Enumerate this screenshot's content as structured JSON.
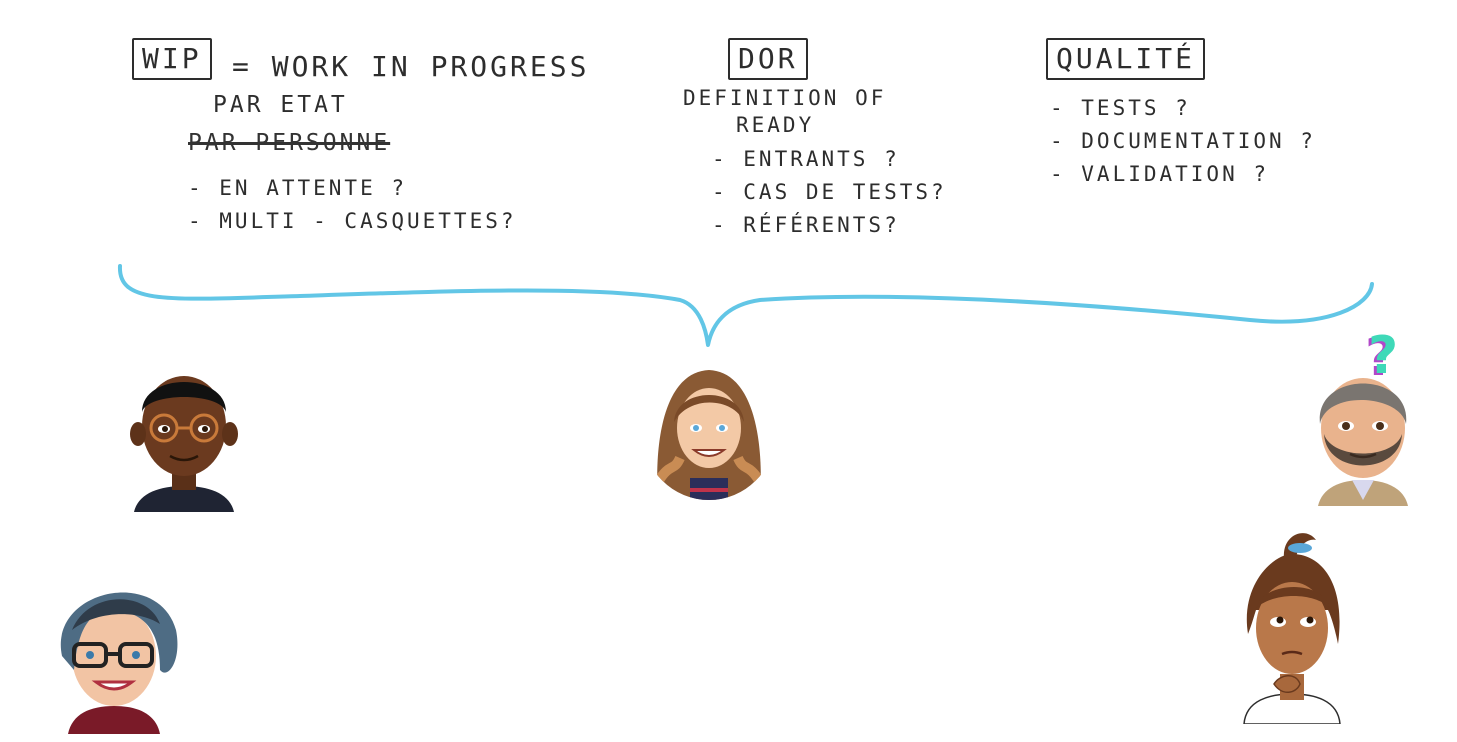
{
  "wip": {
    "box_label": "WIP",
    "equals": "= WORK IN PROGRESS",
    "line1": "PAR ETAT",
    "line2_struck": "PAR PERSONNE",
    "items": [
      "- EN ATTENTE ?",
      "- MULTI - CASQUETTES?"
    ]
  },
  "dor": {
    "box_label": "DOR",
    "line1": "DEFINITION OF",
    "line2": "READY",
    "items": [
      "- ENTRANTS ?",
      "- CAS DE TESTS?",
      "- RÉFÉRENTS?"
    ]
  },
  "qualite": {
    "box_label": "QUALITÉ",
    "items": [
      "- TESTS ?",
      "- DOCUMENTATION ?",
      "- VALIDATION ?"
    ]
  },
  "question_mark": "?",
  "colors": {
    "ink": "#2d2d2d",
    "brace": "#62c6e6",
    "question_mark": "#3fd9b8"
  },
  "avatars": [
    {
      "name": "avatar-man-glasses"
    },
    {
      "name": "avatar-woman-center"
    },
    {
      "name": "avatar-man-beard"
    },
    {
      "name": "avatar-woman-glasses"
    },
    {
      "name": "avatar-woman-thinking"
    }
  ]
}
